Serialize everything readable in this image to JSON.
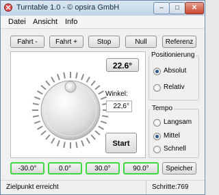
{
  "window": {
    "title": "Turntable 1.0 - © opsira GmbH",
    "minimize_glyph": "–",
    "maximize_glyph": "□",
    "close_glyph": "✕"
  },
  "menu": [
    "Datei",
    "Ansicht",
    "Info"
  ],
  "toolbar": {
    "fahrt_minus": "Fahrt -",
    "fahrt_plus": "Fahrt +",
    "stop": "Stop",
    "null": "Null",
    "referenz": "Referenz"
  },
  "angle_display": "22.6°",
  "winkel": {
    "label": "Winkel:",
    "value": "22,6°"
  },
  "start_label": "Start",
  "positionierung": {
    "title": "Positionierung",
    "options": [
      "Absolut",
      "Relativ"
    ],
    "selected_index": 0
  },
  "tempo": {
    "title": "Tempo",
    "options": [
      "Langsam",
      "Mittel",
      "Schnell"
    ],
    "selected_index": 1
  },
  "presets": [
    "-30.0°",
    "0.0°",
    "30.0°",
    "90.0°"
  ],
  "speicher_label": "Speicher",
  "status": {
    "message": "Zielpunkt erreicht",
    "schritte": "Schritte:769"
  },
  "colors": {
    "preset_border": "#3ed93e",
    "radio_selected": "#2d5a8a"
  },
  "icons": {
    "app": "turntable-cross-icon",
    "knob": "dial-knob-icon"
  }
}
